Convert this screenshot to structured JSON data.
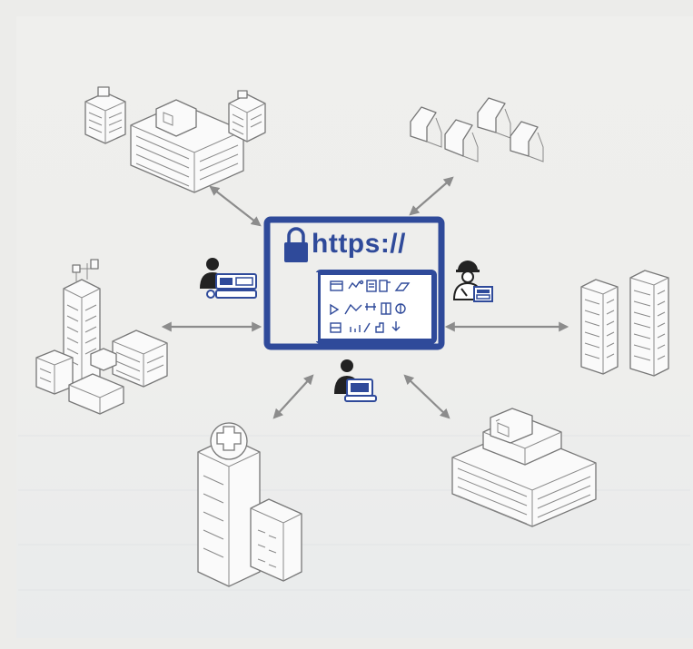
{
  "portal": {
    "url_text": "https://",
    "brand_color": "#2f4a9a"
  },
  "icons": {
    "lock": "lock-icon",
    "operator": "person-at-computer-icon",
    "engineer": "engineer-hardhat-icon",
    "user": "user-laptop-icon"
  },
  "nodes": [
    "office-campus",
    "houses",
    "industrial-complex",
    "twin-towers",
    "hospital",
    "shopping-mall"
  ],
  "colors": {
    "building_stroke": "#777777",
    "arrow": "#8c8c8c",
    "background": "#eeeeec"
  }
}
